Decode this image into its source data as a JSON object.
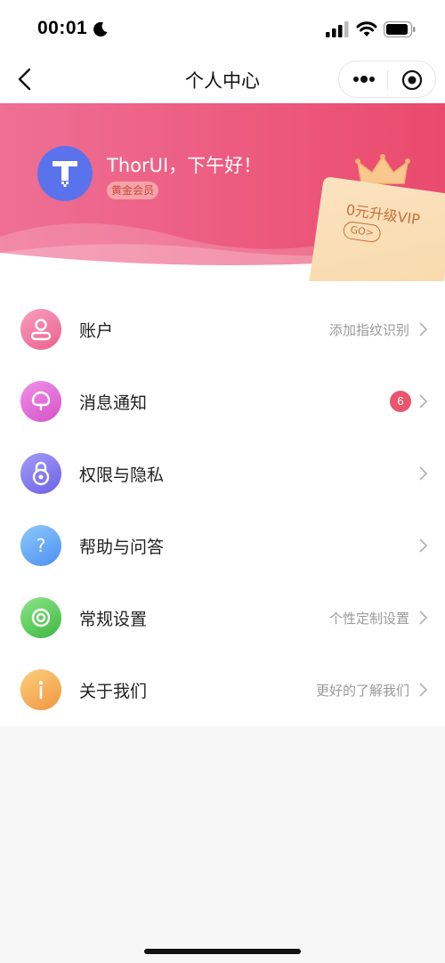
{
  "status_bar": {
    "time": "00:01"
  },
  "nav": {
    "title": "个人中心"
  },
  "header": {
    "greeting": "ThorUI，下午好！",
    "member_badge": "黄金会员",
    "vip_text": "0元升级VIP",
    "vip_go": "GO>",
    "gradient_start": "#ef6f95",
    "gradient_end": "#ea4a6d"
  },
  "menu": {
    "items": [
      {
        "label": "账户",
        "sub": "添加指纹识别",
        "icon": "account-icon",
        "color": "#f06a94"
      },
      {
        "label": "消息通知",
        "sub": "",
        "badge": "6",
        "icon": "notification-icon",
        "color": "#d95fdc"
      },
      {
        "label": "权限与隐私",
        "sub": "",
        "icon": "lock-icon",
        "color": "#7c6df0"
      },
      {
        "label": "帮助与问答",
        "sub": "",
        "icon": "help-icon",
        "color": "#5aa8f6"
      },
      {
        "label": "常规设置",
        "sub": "个性定制设置",
        "icon": "settings-icon",
        "color": "#5ccc5a"
      },
      {
        "label": "关于我们",
        "sub": "更好的了解我们",
        "icon": "info-icon",
        "color": "#f5a444"
      }
    ]
  }
}
